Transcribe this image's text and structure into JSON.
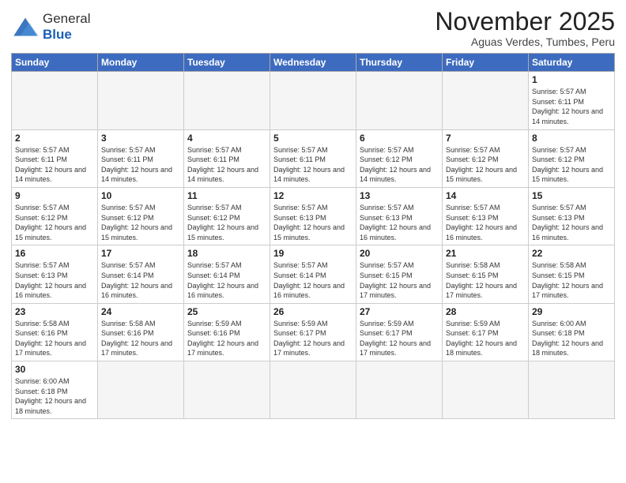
{
  "logo": {
    "text_general": "General",
    "text_blue": "Blue"
  },
  "title": "November 2025",
  "location": "Aguas Verdes, Tumbes, Peru",
  "days_of_week": [
    "Sunday",
    "Monday",
    "Tuesday",
    "Wednesday",
    "Thursday",
    "Friday",
    "Saturday"
  ],
  "weeks": [
    [
      {
        "day": "",
        "info": ""
      },
      {
        "day": "",
        "info": ""
      },
      {
        "day": "",
        "info": ""
      },
      {
        "day": "",
        "info": ""
      },
      {
        "day": "",
        "info": ""
      },
      {
        "day": "",
        "info": ""
      },
      {
        "day": "1",
        "info": "Sunrise: 5:57 AM\nSunset: 6:11 PM\nDaylight: 12 hours\nand 14 minutes."
      }
    ],
    [
      {
        "day": "2",
        "info": "Sunrise: 5:57 AM\nSunset: 6:11 PM\nDaylight: 12 hours\nand 14 minutes."
      },
      {
        "day": "3",
        "info": "Sunrise: 5:57 AM\nSunset: 6:11 PM\nDaylight: 12 hours\nand 14 minutes."
      },
      {
        "day": "4",
        "info": "Sunrise: 5:57 AM\nSunset: 6:11 PM\nDaylight: 12 hours\nand 14 minutes."
      },
      {
        "day": "5",
        "info": "Sunrise: 5:57 AM\nSunset: 6:11 PM\nDaylight: 12 hours\nand 14 minutes."
      },
      {
        "day": "6",
        "info": "Sunrise: 5:57 AM\nSunset: 6:12 PM\nDaylight: 12 hours\nand 14 minutes."
      },
      {
        "day": "7",
        "info": "Sunrise: 5:57 AM\nSunset: 6:12 PM\nDaylight: 12 hours\nand 15 minutes."
      },
      {
        "day": "8",
        "info": "Sunrise: 5:57 AM\nSunset: 6:12 PM\nDaylight: 12 hours\nand 15 minutes."
      }
    ],
    [
      {
        "day": "9",
        "info": "Sunrise: 5:57 AM\nSunset: 6:12 PM\nDaylight: 12 hours\nand 15 minutes."
      },
      {
        "day": "10",
        "info": "Sunrise: 5:57 AM\nSunset: 6:12 PM\nDaylight: 12 hours\nand 15 minutes."
      },
      {
        "day": "11",
        "info": "Sunrise: 5:57 AM\nSunset: 6:12 PM\nDaylight: 12 hours\nand 15 minutes."
      },
      {
        "day": "12",
        "info": "Sunrise: 5:57 AM\nSunset: 6:13 PM\nDaylight: 12 hours\nand 15 minutes."
      },
      {
        "day": "13",
        "info": "Sunrise: 5:57 AM\nSunset: 6:13 PM\nDaylight: 12 hours\nand 16 minutes."
      },
      {
        "day": "14",
        "info": "Sunrise: 5:57 AM\nSunset: 6:13 PM\nDaylight: 12 hours\nand 16 minutes."
      },
      {
        "day": "15",
        "info": "Sunrise: 5:57 AM\nSunset: 6:13 PM\nDaylight: 12 hours\nand 16 minutes."
      }
    ],
    [
      {
        "day": "16",
        "info": "Sunrise: 5:57 AM\nSunset: 6:13 PM\nDaylight: 12 hours\nand 16 minutes."
      },
      {
        "day": "17",
        "info": "Sunrise: 5:57 AM\nSunset: 6:14 PM\nDaylight: 12 hours\nand 16 minutes."
      },
      {
        "day": "18",
        "info": "Sunrise: 5:57 AM\nSunset: 6:14 PM\nDaylight: 12 hours\nand 16 minutes."
      },
      {
        "day": "19",
        "info": "Sunrise: 5:57 AM\nSunset: 6:14 PM\nDaylight: 12 hours\nand 16 minutes."
      },
      {
        "day": "20",
        "info": "Sunrise: 5:57 AM\nSunset: 6:15 PM\nDaylight: 12 hours\nand 17 minutes."
      },
      {
        "day": "21",
        "info": "Sunrise: 5:58 AM\nSunset: 6:15 PM\nDaylight: 12 hours\nand 17 minutes."
      },
      {
        "day": "22",
        "info": "Sunrise: 5:58 AM\nSunset: 6:15 PM\nDaylight: 12 hours\nand 17 minutes."
      }
    ],
    [
      {
        "day": "23",
        "info": "Sunrise: 5:58 AM\nSunset: 6:16 PM\nDaylight: 12 hours\nand 17 minutes."
      },
      {
        "day": "24",
        "info": "Sunrise: 5:58 AM\nSunset: 6:16 PM\nDaylight: 12 hours\nand 17 minutes."
      },
      {
        "day": "25",
        "info": "Sunrise: 5:59 AM\nSunset: 6:16 PM\nDaylight: 12 hours\nand 17 minutes."
      },
      {
        "day": "26",
        "info": "Sunrise: 5:59 AM\nSunset: 6:17 PM\nDaylight: 12 hours\nand 17 minutes."
      },
      {
        "day": "27",
        "info": "Sunrise: 5:59 AM\nSunset: 6:17 PM\nDaylight: 12 hours\nand 17 minutes."
      },
      {
        "day": "28",
        "info": "Sunrise: 5:59 AM\nSunset: 6:17 PM\nDaylight: 12 hours\nand 18 minutes."
      },
      {
        "day": "29",
        "info": "Sunrise: 6:00 AM\nSunset: 6:18 PM\nDaylight: 12 hours\nand 18 minutes."
      }
    ],
    [
      {
        "day": "30",
        "info": "Sunrise: 6:00 AM\nSunset: 6:18 PM\nDaylight: 12 hours\nand 18 minutes."
      },
      {
        "day": "",
        "info": ""
      },
      {
        "day": "",
        "info": ""
      },
      {
        "day": "",
        "info": ""
      },
      {
        "day": "",
        "info": ""
      },
      {
        "day": "",
        "info": ""
      },
      {
        "day": "",
        "info": ""
      }
    ]
  ]
}
